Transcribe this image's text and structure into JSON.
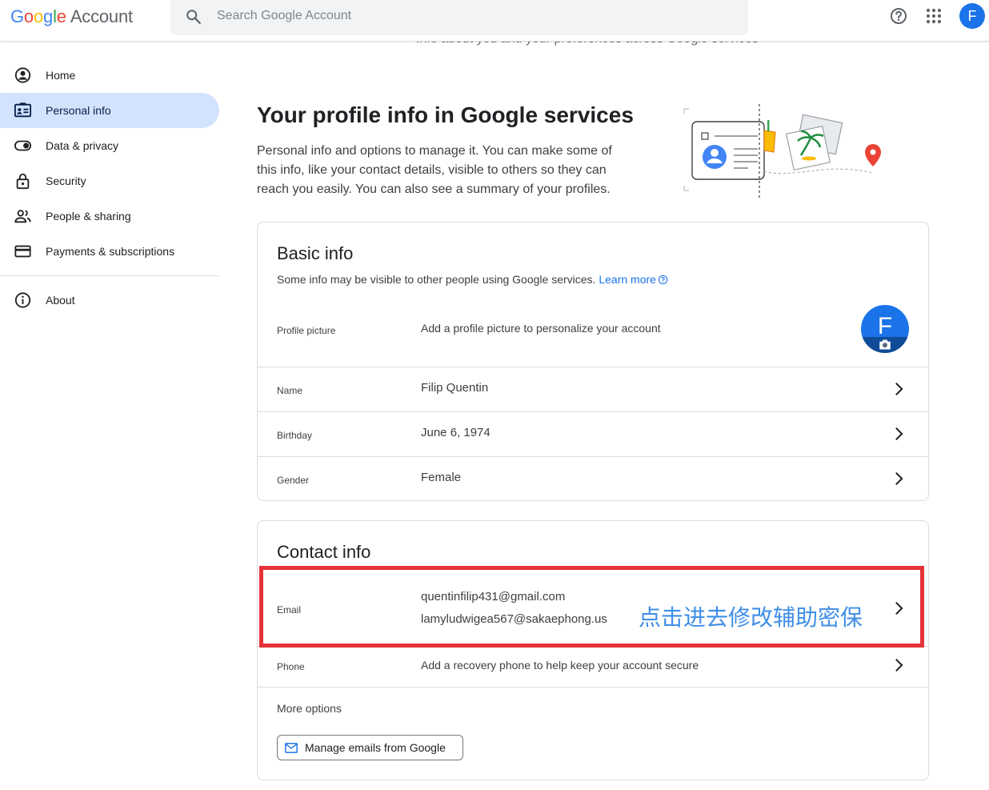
{
  "header": {
    "logo_letters": [
      "G",
      "o",
      "o",
      "g",
      "l",
      "e"
    ],
    "logo_suffix": "Account",
    "search_placeholder": "Search Google Account",
    "avatar_letter": "F",
    "subtitle_peek": "Info about you and your preferences across Google services"
  },
  "sidebar": {
    "items": [
      {
        "label": "Home",
        "icon": "account-circle-icon"
      },
      {
        "label": "Personal info",
        "icon": "id-card-icon",
        "active": true
      },
      {
        "label": "Data & privacy",
        "icon": "toggle-icon"
      },
      {
        "label": "Security",
        "icon": "lock-icon"
      },
      {
        "label": "People & sharing",
        "icon": "people-icon"
      },
      {
        "label": "Payments & subscriptions",
        "icon": "credit-card-icon"
      }
    ],
    "about_label": "About"
  },
  "main": {
    "title": "Your profile info in Google services",
    "description": "Personal info and options to manage it. You can make some of this info, like your contact details, visible to others so they can reach you easily. You can also see a summary of your profiles."
  },
  "basic_info": {
    "title": "Basic info",
    "subtitle": "Some info may be visible to other people using Google services.",
    "learn_more": "Learn more",
    "profile_label": "Profile picture",
    "profile_value": "Add a profile picture to personalize your account",
    "profile_letter": "F",
    "name_label": "Name",
    "name_value": "Filip Quentin",
    "birthday_label": "Birthday",
    "birthday_value": "June 6, 1974",
    "gender_label": "Gender",
    "gender_value": "Female"
  },
  "contact_info": {
    "title": "Contact info",
    "email_label": "Email",
    "email_primary": "quentinfilip431@gmail.com",
    "email_secondary": "lamyludwigea567@sakaephong.us",
    "phone_label": "Phone",
    "phone_value": "Add a recovery phone to help keep your account secure",
    "more_options": "More options",
    "manage_button": "Manage emails from Google"
  },
  "annotation": {
    "text": "点击进去修改辅助密保",
    "box_color": "#e53238",
    "text_color": "#3f8ee8"
  },
  "colors": {
    "active_nav": "#d3e3fd",
    "link": "#1a73e8",
    "avatar": "#1a73e8"
  }
}
